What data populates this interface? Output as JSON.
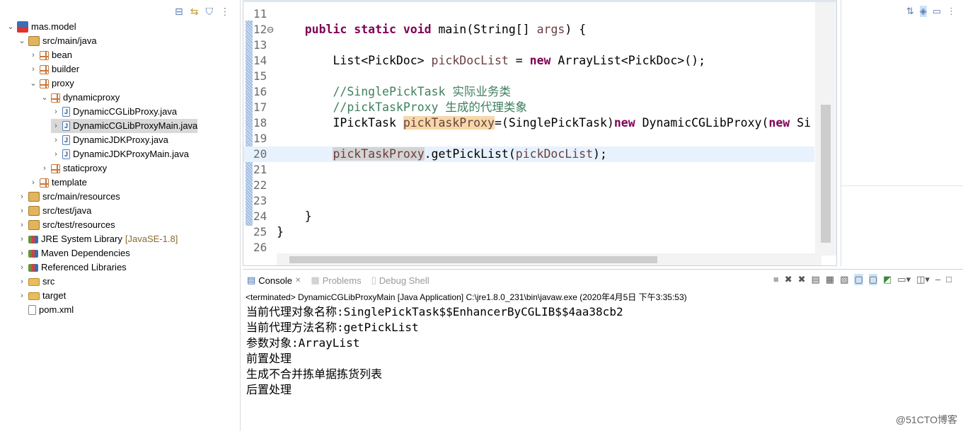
{
  "explorer": {
    "toolbar": [
      "collapse-all-icon",
      "link-with-editor-icon",
      "filter-icon",
      "view-menu-icon"
    ],
    "items": [
      {
        "label": "mas.model",
        "level": 0,
        "icon": "proj",
        "chev": "v"
      },
      {
        "label": "src/main/java",
        "level": 1,
        "icon": "src",
        "chev": "v"
      },
      {
        "label": "bean",
        "level": 2,
        "icon": "pkg",
        "chev": ">"
      },
      {
        "label": "builder",
        "level": 2,
        "icon": "pkg",
        "chev": ">"
      },
      {
        "label": "proxy",
        "level": 2,
        "icon": "pkg",
        "chev": "v"
      },
      {
        "label": "dynamicproxy",
        "level": 3,
        "icon": "pkg",
        "chev": "v"
      },
      {
        "label": "DynamicCGLibProxy.java",
        "level": 4,
        "icon": "java",
        "chev": ">"
      },
      {
        "label": "DynamicCGLibProxyMain.java",
        "level": 4,
        "icon": "java",
        "chev": ">",
        "selected": true
      },
      {
        "label": "DynamicJDKProxy.java",
        "level": 4,
        "icon": "java",
        "chev": ">"
      },
      {
        "label": "DynamicJDKProxyMain.java",
        "level": 4,
        "icon": "java",
        "chev": ">"
      },
      {
        "label": "staticproxy",
        "level": 3,
        "icon": "pkg",
        "chev": ">"
      },
      {
        "label": "template",
        "level": 2,
        "icon": "pkg",
        "chev": ">"
      },
      {
        "label": "src/main/resources",
        "level": 1,
        "icon": "src",
        "chev": ">"
      },
      {
        "label": "src/test/java",
        "level": 1,
        "icon": "src",
        "chev": ">"
      },
      {
        "label": "src/test/resources",
        "level": 1,
        "icon": "src",
        "chev": ">"
      },
      {
        "label": "JRE System Library",
        "level": 1,
        "icon": "lib",
        "chev": ">",
        "suffix": "[JavaSE-1.8]"
      },
      {
        "label": "Maven Dependencies",
        "level": 1,
        "icon": "lib",
        "chev": ">"
      },
      {
        "label": "Referenced Libraries",
        "level": 1,
        "icon": "lib",
        "chev": ">"
      },
      {
        "label": "src",
        "level": 1,
        "icon": "folder",
        "chev": ">"
      },
      {
        "label": "target",
        "level": 1,
        "icon": "folder",
        "chev": ">"
      },
      {
        "label": "pom.xml",
        "level": 1,
        "icon": "xml",
        "chev": ""
      }
    ]
  },
  "editor": {
    "lines": [
      {
        "n": "11",
        "seg": []
      },
      {
        "n": "12⊖",
        "seg": [
          [
            "    ",
            ""
          ],
          [
            "public static void",
            "kw"
          ],
          [
            " main(String[] ",
            ""
          ],
          [
            "args",
            "var"
          ],
          [
            ") {",
            ""
          ]
        ]
      },
      {
        "n": "13",
        "seg": []
      },
      {
        "n": "14",
        "seg": [
          [
            "        List<PickDoc> ",
            ""
          ],
          [
            "pickDocList",
            "var"
          ],
          [
            " = ",
            ""
          ],
          [
            "new",
            "kw"
          ],
          [
            " ArrayList<PickDoc>();",
            ""
          ]
        ]
      },
      {
        "n": "15",
        "seg": []
      },
      {
        "n": "16",
        "seg": [
          [
            "        ",
            ""
          ],
          [
            "//SinglePickTask 实际业务类",
            "cm"
          ]
        ]
      },
      {
        "n": "17",
        "seg": [
          [
            "        ",
            ""
          ],
          [
            "//pickTaskProxy 生成的代理类象",
            "cm"
          ]
        ]
      },
      {
        "n": "18",
        "seg": [
          [
            "        IPickTask ",
            ""
          ],
          [
            "pickTaskProxy",
            "var hl"
          ],
          [
            "=(SinglePickTask)",
            ""
          ],
          [
            "new",
            "kw"
          ],
          [
            " DynamicCGLibProxy(",
            ""
          ],
          [
            "new",
            "kw"
          ],
          [
            " Si",
            ""
          ]
        ]
      },
      {
        "n": "19",
        "seg": []
      },
      {
        "n": "20",
        "seg": [
          [
            "        ",
            ""
          ],
          [
            "pickTaskProxy",
            "var hl2"
          ],
          [
            ".getPickList(",
            ""
          ],
          [
            "pickDocList",
            "var"
          ],
          [
            ");",
            ""
          ]
        ],
        "current": true
      },
      {
        "n": "21",
        "seg": []
      },
      {
        "n": "22",
        "seg": []
      },
      {
        "n": "23",
        "seg": []
      },
      {
        "n": "24",
        "seg": [
          [
            "    }",
            ""
          ]
        ]
      },
      {
        "n": "25",
        "seg": [
          [
            "}",
            ""
          ]
        ]
      },
      {
        "n": "26",
        "seg": []
      }
    ]
  },
  "console": {
    "tabs": [
      {
        "label": "Console",
        "active": true,
        "close": "✕"
      },
      {
        "label": "Problems"
      },
      {
        "label": "Debug Shell"
      }
    ],
    "status": "<terminated> DynamicCGLibProxyMain [Java Application] C:\\jre1.8.0_231\\bin\\javaw.exe (2020年4月5日 下午3:35:53)",
    "output": [
      "当前代理对象名称:SinglePickTask$$EnhancerByCGLIB$$4aa38cb2",
      "当前代理方法名称:getPickList",
      "参数对象:ArrayList",
      "前置处理",
      "生成不合并拣单据拣货列表",
      "后置处理"
    ]
  },
  "watermark": "@51CTO博客"
}
